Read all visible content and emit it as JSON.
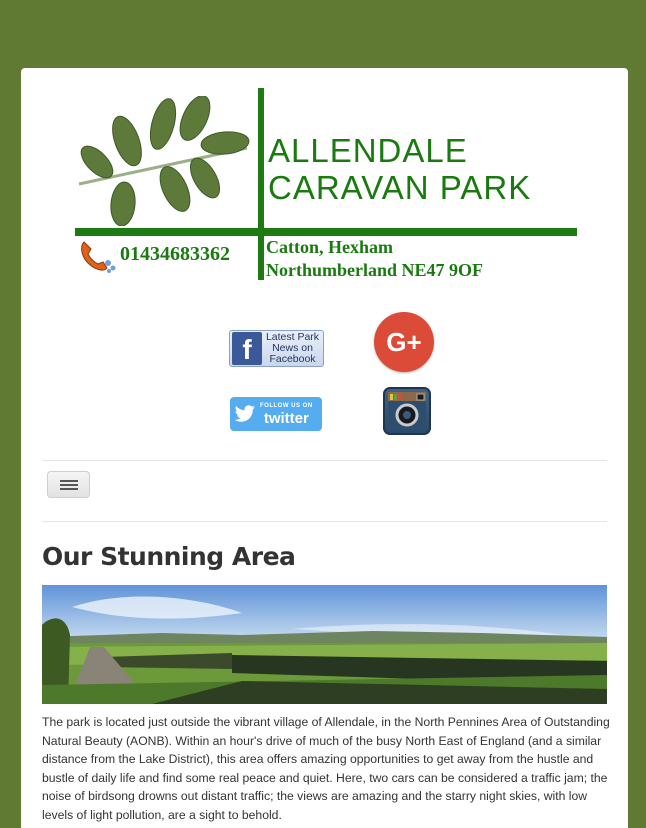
{
  "header": {
    "park_name_line1": "ALLENDALE",
    "park_name_line2": "CARAVAN PARK",
    "phone": "01434683362",
    "address_line1": "Catton, Hexham",
    "address_line2": "Northumberland NE47 9OF"
  },
  "social": {
    "facebook_text": "Latest Park News on Facebook",
    "google_plus_text": "G+",
    "twitter_small": "FOLLOW US ON",
    "twitter_big": "twitter"
  },
  "content": {
    "title": "Our Stunning Area",
    "paragraph": "The park is located just outside the vibrant village of Allendale, in the North Pennines Area of Outstanding Natural Beauty (AONB). Within an hour's drive of much of the busy North East of England (and a similar distance from the Lake District),  this area offers amazing opportunities to get away from the hustle and bustle of daily life and find some real peace and quiet. Here, two cars can be considered a traffic jam; the noise of birdsong drowns out distant traffic; the views are amazing and the starry night skies, with low levels of light pollution, are a sight to behold."
  },
  "colors": {
    "page_background": "#607a34",
    "brand_green": "#1a7a10",
    "facebook_blue": "#3b5998",
    "google_red": "#dc4a38",
    "twitter_blue": "#55acee"
  }
}
